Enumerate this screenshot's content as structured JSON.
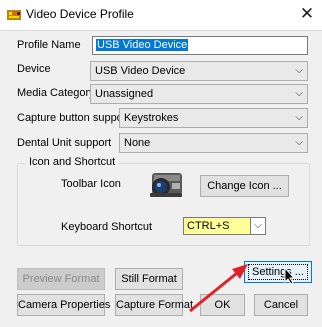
{
  "window": {
    "title": "Video Device Profile",
    "close_glyph": "✕"
  },
  "form": {
    "profile_name": {
      "label": "Profile Name",
      "value": "USB Video Device"
    },
    "device": {
      "label": "Device",
      "value": "USB Video Device"
    },
    "media_category": {
      "label": "Media Category",
      "value": "Unassigned"
    },
    "capture_button_support": {
      "label": "Capture button support",
      "value": "Keystrokes"
    },
    "dental_unit_support": {
      "label": "Dental Unit support",
      "value": "None"
    }
  },
  "icon_group": {
    "title": "Icon and Shortcut",
    "toolbar_icon_label": "Toolbar Icon",
    "toolbar_icon": "camera-icon",
    "change_icon_button": "Change Icon ...",
    "keyboard_shortcut_label": "Keyboard Shortcut",
    "keyboard_shortcut_value": "CTRL+S"
  },
  "buttons": {
    "preview_format": "Preview Format",
    "still_format": "Still Format",
    "settings": "Settings ...",
    "camera_properties": "Camera Properties",
    "capture_format": "Capture Format",
    "ok": "OK",
    "cancel": "Cancel"
  },
  "annotation": {
    "arrow_color": "#e0202a"
  },
  "colors": {
    "selection": "#0078d7",
    "shortcut_highlight": "#ffff99"
  }
}
